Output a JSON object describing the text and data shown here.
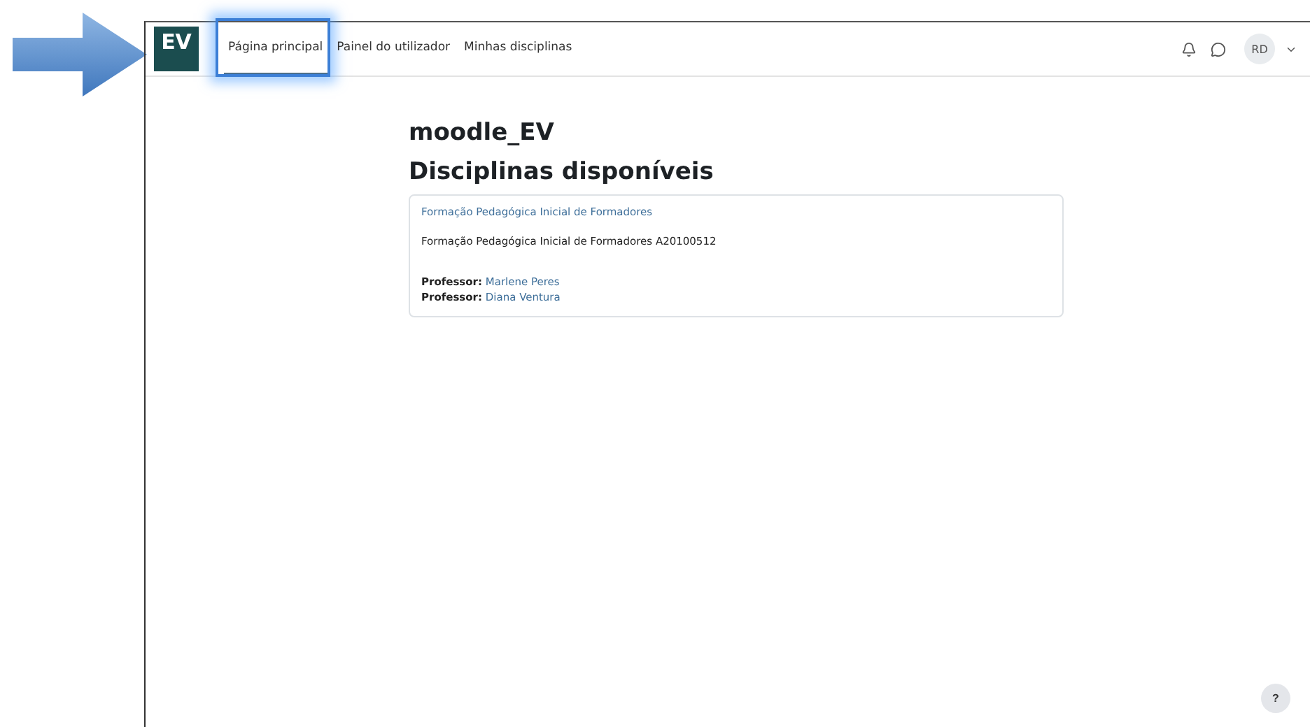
{
  "navbar": {
    "logo": "EV",
    "links": [
      {
        "label": "Página principal",
        "selected": true
      },
      {
        "label": "Painel do utilizador",
        "selected": false
      },
      {
        "label": "Minhas disciplinas",
        "selected": false
      }
    ],
    "user_initials": "RD"
  },
  "site_title": "moodle_EV",
  "section_title": "Disciplinas disponíveis",
  "courses": [
    {
      "name": "Formação Pedagógica Inicial de Formadores",
      "summary": "Formação Pedagógica Inicial de Formadores A20100512",
      "teachers": [
        {
          "role": "Professor:",
          "name": "Marlene Peres"
        },
        {
          "role": "Professor:",
          "name": "Diana Ventura"
        }
      ]
    }
  ],
  "help_button": "?"
}
